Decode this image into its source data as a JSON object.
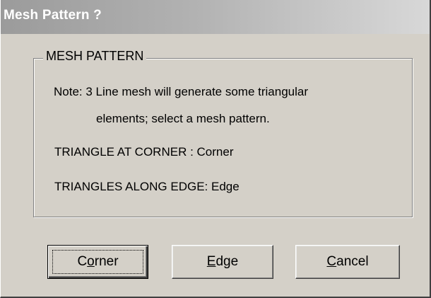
{
  "window": {
    "title": "Mesh Pattern ?"
  },
  "group": {
    "label": "MESH PATTERN",
    "note_line1": "Note: 3 Line mesh will generate some triangular",
    "note_line2": "elements; select  a  mesh pattern.",
    "corner_option": "TRIANGLE  AT CORNER  : Corner",
    "edge_option": "TRIANGLES ALONG EDGE: Edge"
  },
  "buttons": {
    "corner": {
      "before": "C",
      "mnemonic": "o",
      "after": "rner"
    },
    "edge": {
      "before": "",
      "mnemonic": "E",
      "after": "dge"
    },
    "cancel": {
      "before": "",
      "mnemonic": "C",
      "after": "ancel"
    },
    "default": "corner"
  },
  "colors": {
    "dialog_face": "#d4d0c8",
    "titlebar_start": "#9b9b9b",
    "titlebar_end": "#d8d8d8",
    "title_text": "#ffffff"
  }
}
